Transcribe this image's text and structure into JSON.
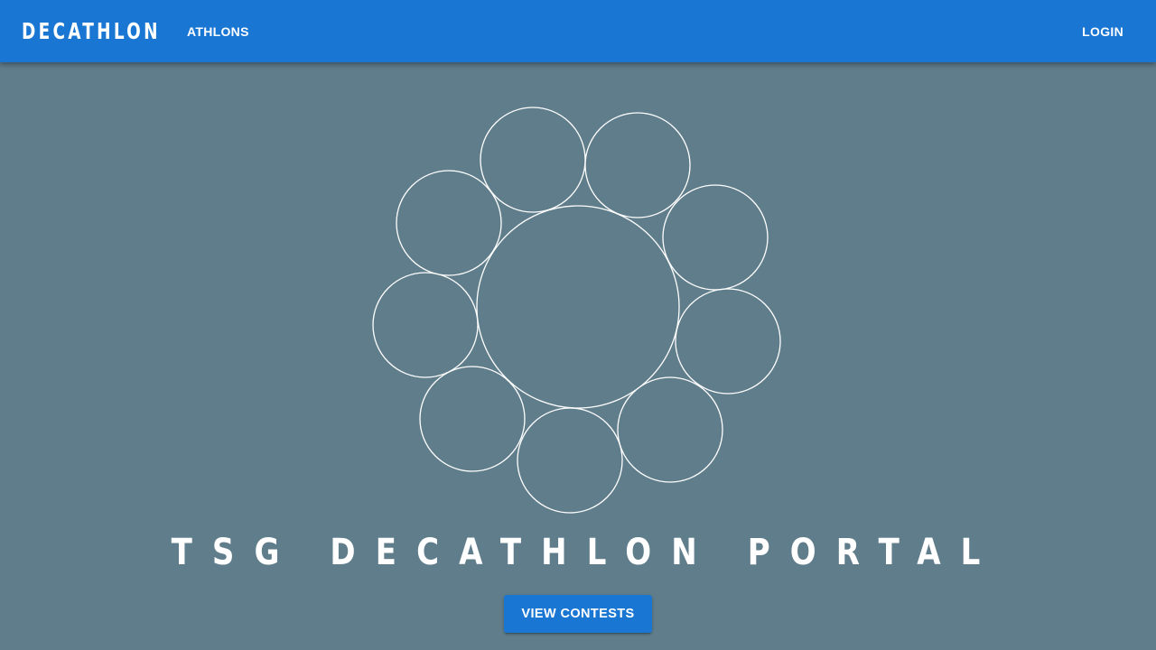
{
  "header": {
    "brand": "DECATHLON",
    "nav_athlons": "ATHLONS",
    "nav_login": "LOGIN"
  },
  "hero": {
    "logo_icon": "decathlon-circles-logo",
    "title": "TSG DECATHLON PORTAL",
    "cta_label": "VIEW CONTESTS"
  },
  "colors": {
    "appbar": "#1976d2",
    "background": "#607d8b",
    "button": "#1976d2",
    "text": "#ffffff"
  }
}
